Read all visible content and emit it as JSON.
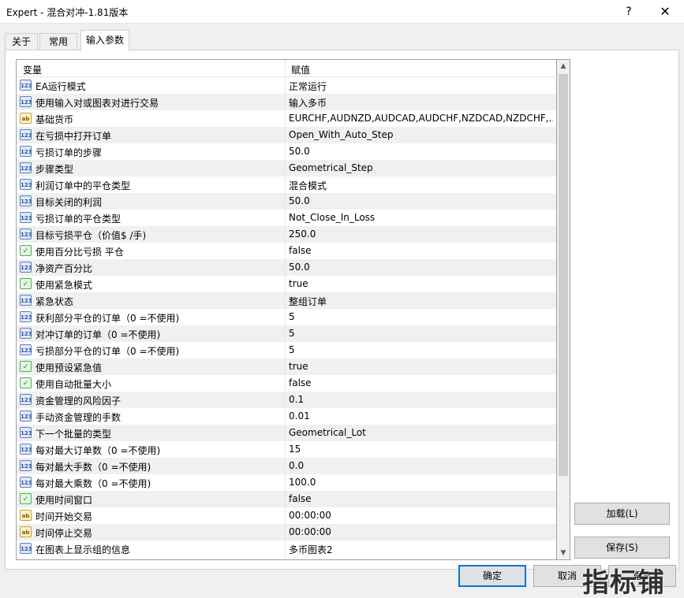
{
  "window": {
    "title": "Expert - 混合对冲-1.81版本",
    "help_glyph": "?",
    "close_glyph": "✕"
  },
  "tabs": [
    {
      "label": "关于"
    },
    {
      "label": "常用"
    },
    {
      "label": "输入参数"
    }
  ],
  "grid": {
    "col_variable": "变量",
    "col_value": "赋值",
    "rows": [
      {
        "type": "num",
        "name": "EA运行模式",
        "value": "正常运行"
      },
      {
        "type": "num",
        "name": "使用输入对或图表对进行交易",
        "value": "输入多币"
      },
      {
        "type": "str",
        "name": "基础货币",
        "value": "EURCHF,AUDNZD,AUDCAD,AUDCHF,NZDCAD,NZDCHF,..."
      },
      {
        "type": "num",
        "name": "在亏损中打开订单",
        "value": "Open_With_Auto_Step"
      },
      {
        "type": "num",
        "name": "亏损订单的步骤",
        "value": "50.0"
      },
      {
        "type": "num",
        "name": "步骤类型",
        "value": "Geometrical_Step"
      },
      {
        "type": "num",
        "name": "利润订单中的平仓类型",
        "value": "混合模式"
      },
      {
        "type": "num",
        "name": "目标关闭的利润",
        "value": "50.0"
      },
      {
        "type": "num",
        "name": "亏损订单的平仓类型",
        "value": "Not_Close_In_Loss"
      },
      {
        "type": "num",
        "name": "目标亏损平仓（价值$ /手)",
        "value": "250.0"
      },
      {
        "type": "bool",
        "name": "使用百分比亏损 平仓",
        "value": "false"
      },
      {
        "type": "num",
        "name": "净资产百分比",
        "value": "50.0"
      },
      {
        "type": "bool",
        "name": "使用紧急模式",
        "value": "true"
      },
      {
        "type": "num",
        "name": "紧急状态",
        "value": "整组订单"
      },
      {
        "type": "num",
        "name": "获利部分平仓的订单（0 =不使用)",
        "value": "5"
      },
      {
        "type": "num",
        "name": "对冲订单的订单（0 =不使用)",
        "value": "5"
      },
      {
        "type": "num",
        "name": "亏损部分平仓的订单（0 =不使用)",
        "value": "5"
      },
      {
        "type": "bool",
        "name": "使用预设紧急值",
        "value": "true"
      },
      {
        "type": "bool",
        "name": "使用自动批量大小",
        "value": "false"
      },
      {
        "type": "num",
        "name": "资金管理的风险因子",
        "value": "0.1"
      },
      {
        "type": "num",
        "name": "手动资金管理的手数",
        "value": "0.01"
      },
      {
        "type": "num",
        "name": "下一个批量的类型",
        "value": "Geometrical_Lot"
      },
      {
        "type": "num",
        "name": "每对最大订单数（0 =不使用)",
        "value": "15"
      },
      {
        "type": "num",
        "name": "每对最大手数（0 =不使用)",
        "value": "0.0"
      },
      {
        "type": "num",
        "name": "每对最大乘数（0 =不使用)",
        "value": "100.0"
      },
      {
        "type": "bool",
        "name": "使用时间窗口",
        "value": "false"
      },
      {
        "type": "str",
        "name": "时间开始交易",
        "value": "00:00:00"
      },
      {
        "type": "str",
        "name": "时间停止交易",
        "value": "00:00:00"
      },
      {
        "type": "num",
        "name": "在图表上显示组的信息",
        "value": "多币图表2"
      }
    ]
  },
  "icons": {
    "num": "123",
    "str": "ab",
    "bool": "✓"
  },
  "buttons": {
    "load": "加载(L)",
    "save": "保存(S)",
    "ok": "确定",
    "cancel": "取消",
    "reset": "重置"
  },
  "watermark": "指标铺"
}
